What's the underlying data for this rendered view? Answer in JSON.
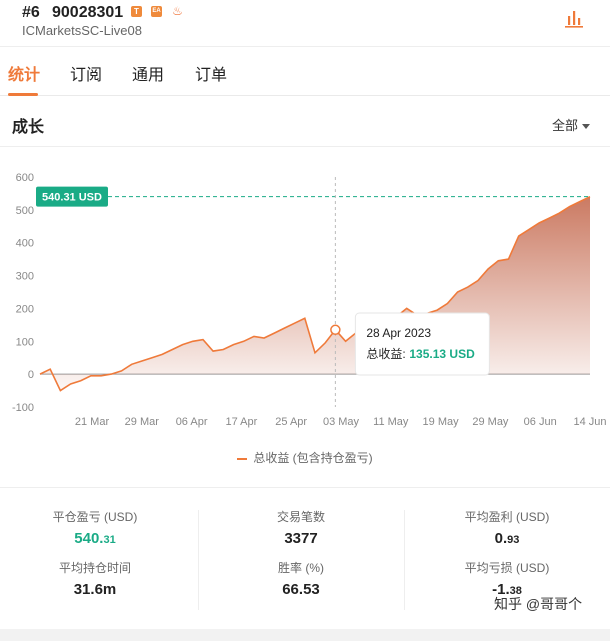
{
  "header": {
    "rank": "#6",
    "account_id": "90028301",
    "badges": [
      {
        "icon": "t-badge-icon",
        "text": "T",
        "color": "#ef8a3b"
      },
      {
        "icon": "ea-badge-icon",
        "text": "EA",
        "color": "#ef8a3b"
      },
      {
        "icon": "fire-badge-icon",
        "text": "♨",
        "color": "#ef6a2b"
      }
    ],
    "server": "ICMarketsSC-Live08",
    "chart_icon": "bar-chart-icon"
  },
  "tabs": [
    {
      "label": "统计",
      "active": true
    },
    {
      "label": "订阅",
      "active": false
    },
    {
      "label": "通用",
      "active": false
    },
    {
      "label": "订单",
      "active": false
    }
  ],
  "section": {
    "title": "成长",
    "range": "全部"
  },
  "colors": {
    "accent": "#ef7a3a",
    "positive": "#1aab86",
    "fill": "#c8735a"
  },
  "chart_data": {
    "type": "area",
    "yticks": [
      600,
      500,
      400,
      300,
      200,
      100,
      0,
      -100
    ],
    "ylim": [
      -100,
      600
    ],
    "xticks": [
      "21 Mar",
      "29 Mar",
      "06 Apr",
      "17 Apr",
      "25 Apr",
      "03 May",
      "11 May",
      "19 May",
      "29 May",
      "06 Jun",
      "14 Jun"
    ],
    "current_label": "540.31 USD",
    "current_value": 540.31,
    "series": [
      {
        "name": "总收益 (包含持仓盈亏)",
        "values": [
          0,
          15,
          -50,
          -30,
          -20,
          -5,
          -5,
          0,
          10,
          30,
          40,
          50,
          60,
          75,
          90,
          100,
          105,
          70,
          75,
          90,
          100,
          115,
          110,
          125,
          140,
          155,
          170,
          65,
          95,
          135,
          100,
          125,
          165,
          160,
          150,
          175,
          200,
          180,
          185,
          195,
          215,
          250,
          265,
          285,
          320,
          345,
          350,
          420,
          440,
          460,
          475,
          490,
          510,
          525,
          540
        ]
      }
    ],
    "tooltip": {
      "date": "28 Apr 2023",
      "label": "总收益:",
      "value": "135.13 USD",
      "point_index": 29
    }
  },
  "stats": [
    {
      "label": "平仓盈亏 (USD)",
      "value_main": "540.",
      "value_small": "31",
      "color": "positive"
    },
    {
      "label": "交易笔数",
      "value_main": "3377",
      "value_small": "",
      "color": "normal"
    },
    {
      "label": "平均盈利 (USD)",
      "value_main": "0.",
      "value_small": "93",
      "color": "normal"
    },
    {
      "label": "平均持仓时间",
      "value_main": "31.6m",
      "value_small": "",
      "color": "normal"
    },
    {
      "label": "胜率 (%)",
      "value_main": "66.53",
      "value_small": "",
      "color": "normal"
    },
    {
      "label": "平均亏损 (USD)",
      "value_main": "-1.",
      "value_small": "38",
      "color": "normal"
    }
  ],
  "watermark": "知乎 @哥哥个"
}
